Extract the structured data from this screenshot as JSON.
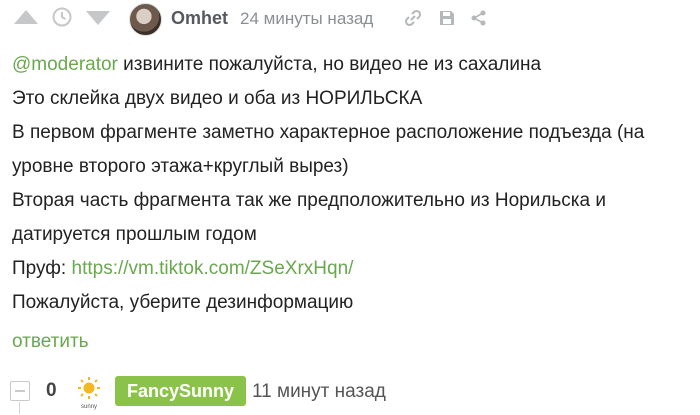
{
  "comment": {
    "author": "Omhet",
    "time": "24 минуты назад",
    "mention": "@moderator",
    "line1_rest": " извините пожалуйста, но видео не из сахалина",
    "line2": "Это склейка двух видео и оба из НОРИЛЬСКА",
    "line3": "В первом фрагменте заметно характерное расположение подъезда (на уровне второго этажа+круглый вырез)",
    "line4": "Вторая часть фрагмента так же предположительно из Норильска и датируется прошлым годом",
    "proof_label": "Пруф: ",
    "proof_link": "https://vm.tiktok.com/ZSeXrxHqn/",
    "line6": "Пожалуйста, уберите дезинформацию",
    "reply": "ответить",
    "icons": [
      "upvote-icon",
      "clock-icon",
      "downvote-icon",
      "link-icon",
      "save-icon",
      "share-icon"
    ]
  },
  "next_comment": {
    "score": "0",
    "avatar_label": "sunny",
    "author": "FancySunny",
    "time": "11 минут назад"
  },
  "colors": {
    "accent": "#6aa84f",
    "badge": "#8bc34a",
    "muted": "#c5c7c9"
  }
}
